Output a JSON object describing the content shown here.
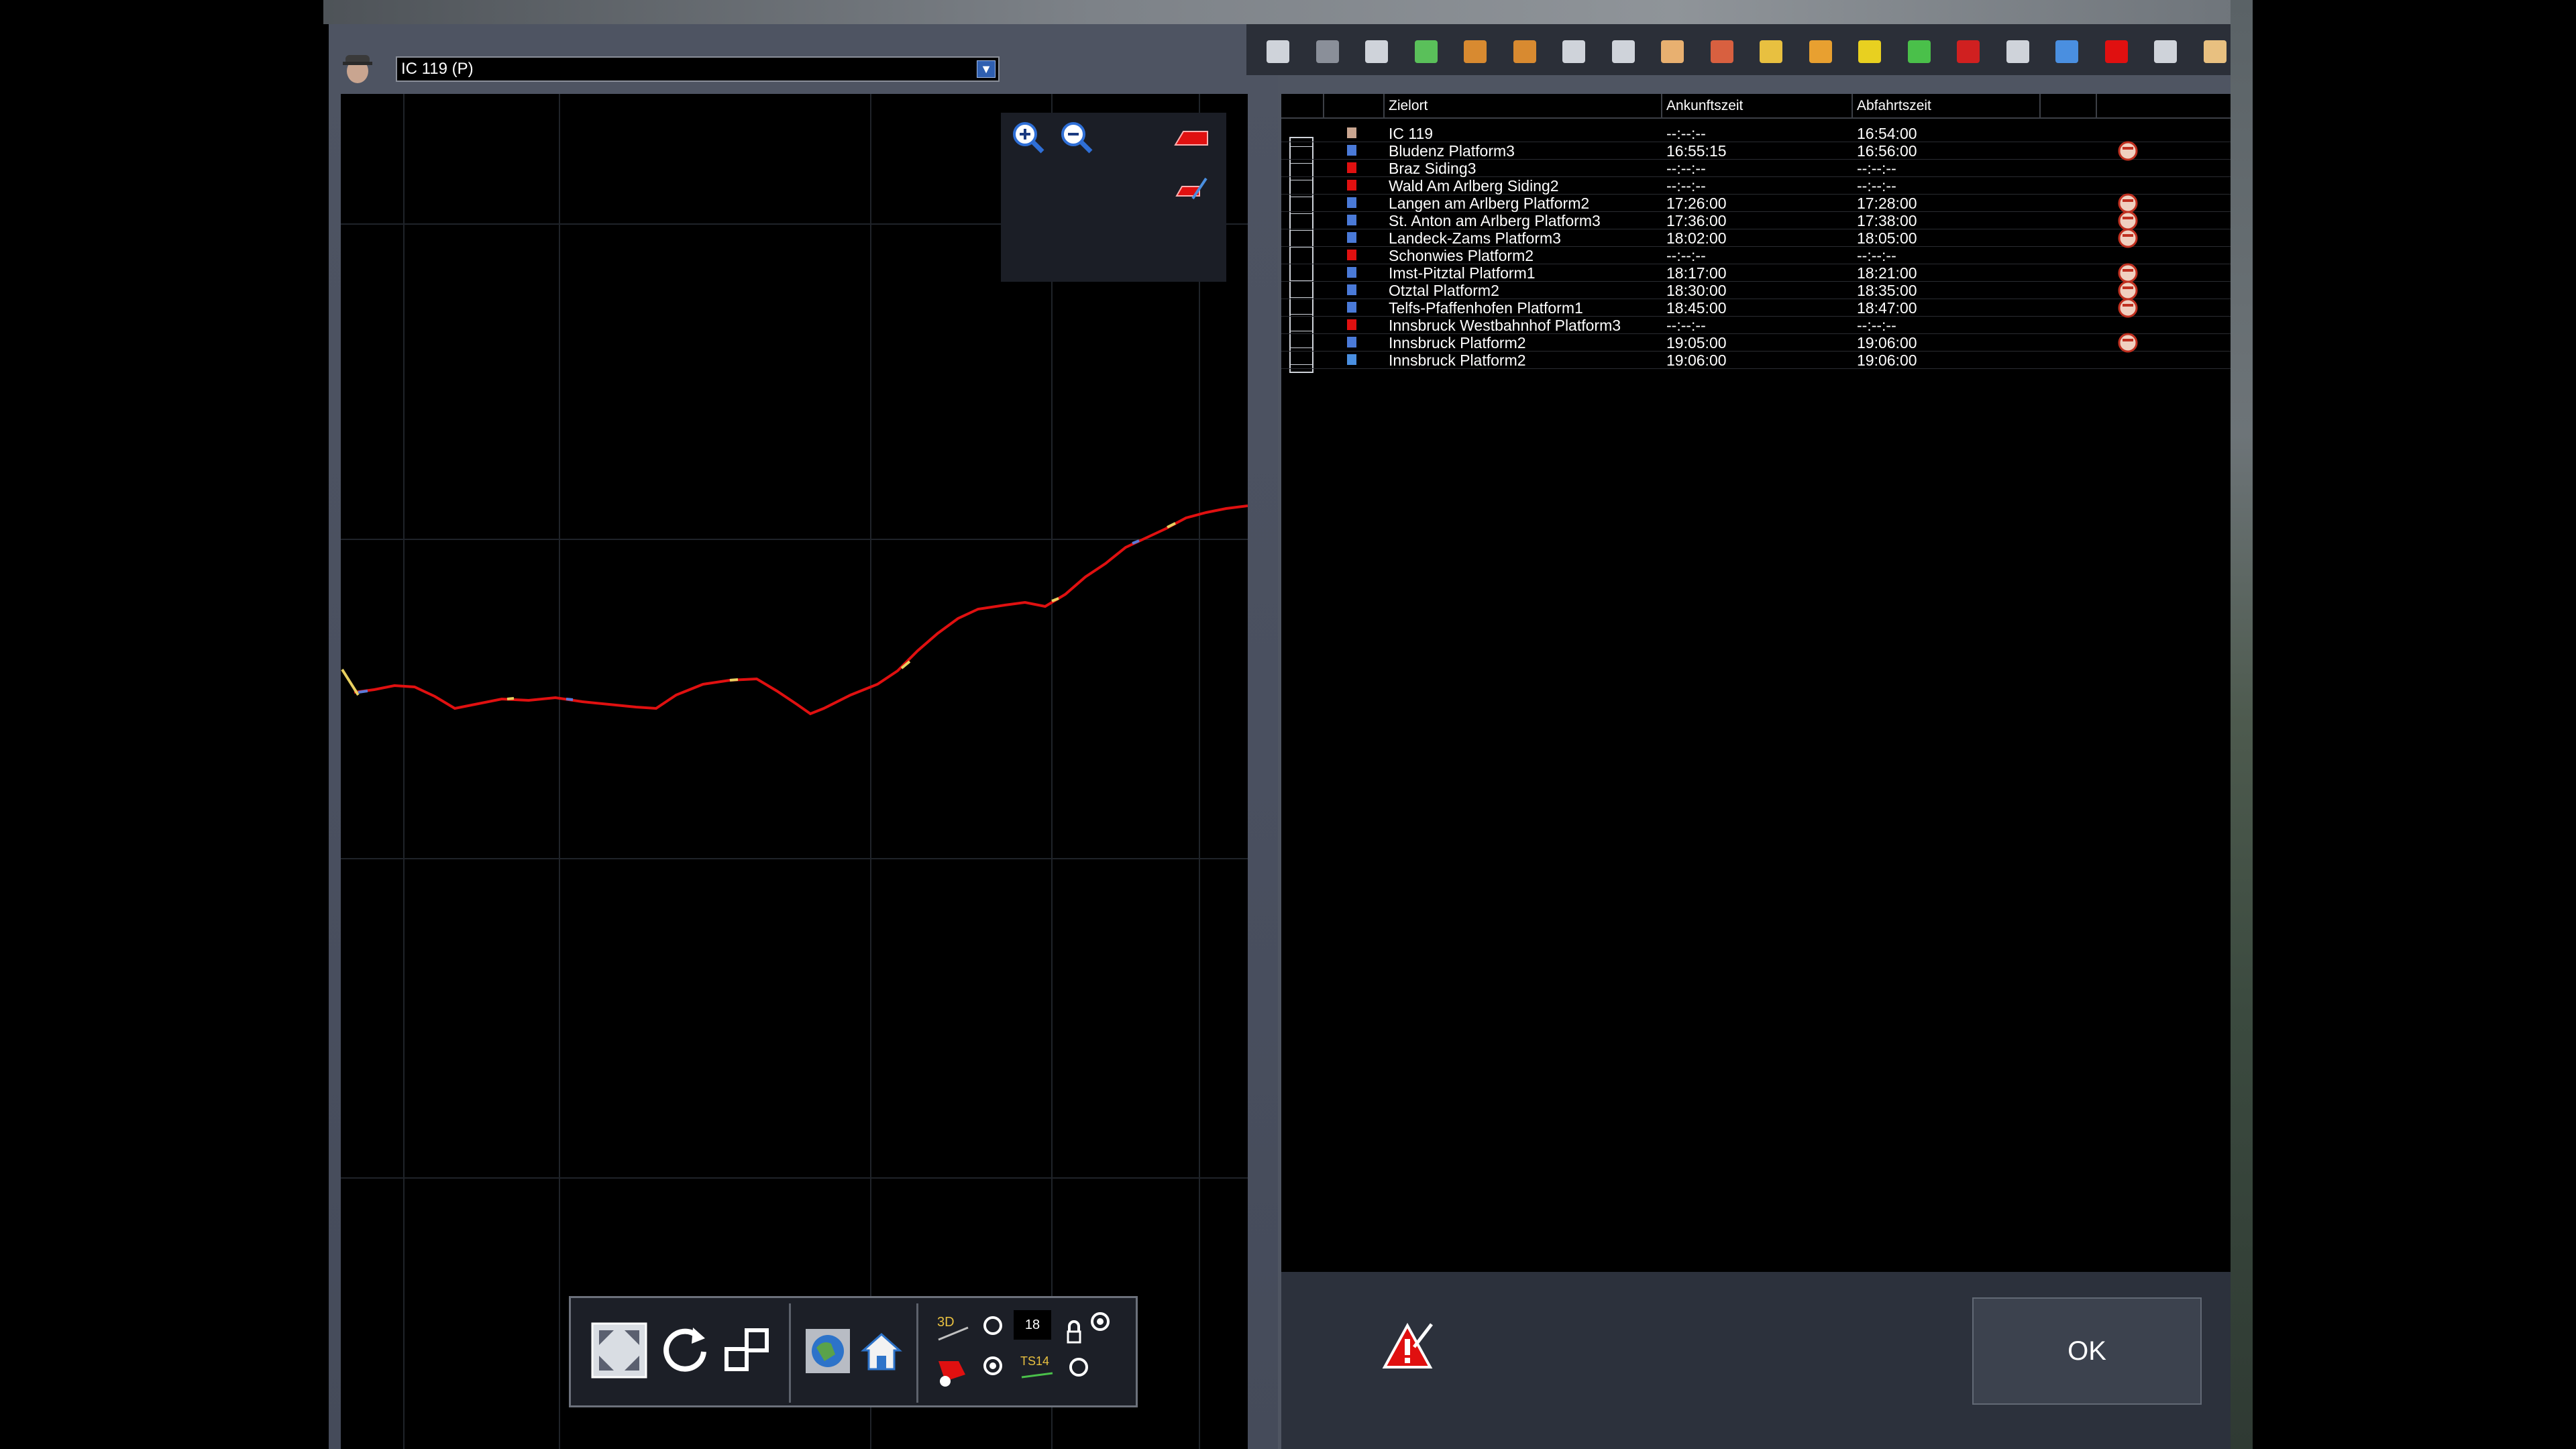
{
  "train": {
    "selected": "IC 119 (P)",
    "dropdown_glyph": "▼",
    "driver_icon": "driver-head-icon"
  },
  "map_tools": [
    {
      "name": "zoom-in-icon"
    },
    {
      "name": "zoom-out-icon"
    },
    {
      "name": "red-train-shape-icon"
    },
    {
      "name": "red-pencil-shape-icon"
    }
  ],
  "bottom_bar": {
    "speed_value": "18",
    "label_3d": "3D",
    "label_ts14": "TS14"
  },
  "toolbar_icons": [
    "save-icon",
    "trash-icon",
    "grid-small-icon",
    "grid-green-icon",
    "move-up-icon",
    "move-down-icon",
    "align-icon",
    "align-right-icon",
    "pointing-hand-icon",
    "passengers-icon",
    "edit-list-icon",
    "expand-icon",
    "add-arrow-icon",
    "add-green-icon",
    "remove-icon",
    "settings-icon",
    "exit-icon",
    "red-flag-icon",
    "panel-icon",
    "train-car-icon"
  ],
  "timetable": {
    "headers": {
      "destination": "Zielort",
      "arrival": "Ankunftszeit",
      "departure": "Abfahrtszeit"
    },
    "rows": [
      {
        "type": "head",
        "dest": "IC 119",
        "arr": "--:--:--",
        "dep": "16:54:00",
        "badge": false
      },
      {
        "type": "stop",
        "dest": "Bludenz Platform3",
        "arr": "16:55:15",
        "dep": "16:56:00",
        "badge": true
      },
      {
        "type": "flag",
        "dest": "Braz Siding3",
        "arr": "--:--:--",
        "dep": "--:--:--",
        "badge": false
      },
      {
        "type": "flag",
        "dest": "Wald Am Arlberg Siding2",
        "arr": "--:--:--",
        "dep": "--:--:--",
        "badge": false
      },
      {
        "type": "stop",
        "dest": "Langen am Arlberg Platform2",
        "arr": "17:26:00",
        "dep": "17:28:00",
        "badge": true
      },
      {
        "type": "stop",
        "dest": "St. Anton am Arlberg Platform3",
        "arr": "17:36:00",
        "dep": "17:38:00",
        "badge": true
      },
      {
        "type": "stop",
        "dest": "Landeck-Zams Platform3",
        "arr": "18:02:00",
        "dep": "18:05:00",
        "badge": true
      },
      {
        "type": "flag",
        "dest": "Schonwies Platform2",
        "arr": "--:--:--",
        "dep": "--:--:--",
        "badge": false
      },
      {
        "type": "stop",
        "dest": "Imst-Pitztal Platform1",
        "arr": "18:17:00",
        "dep": "18:21:00",
        "badge": true
      },
      {
        "type": "stop",
        "dest": "Otztal Platform2",
        "arr": "18:30:00",
        "dep": "18:35:00",
        "badge": true
      },
      {
        "type": "stop",
        "dest": "Telfs-Pfaffenhofen Platform1",
        "arr": "18:45:00",
        "dep": "18:47:00",
        "badge": true
      },
      {
        "type": "flag",
        "dest": "Innsbruck Westbahnhof Platform3",
        "arr": "--:--:--",
        "dep": "--:--:--",
        "badge": false
      },
      {
        "type": "stop",
        "dest": "Innsbruck Platform2",
        "arr": "19:05:00",
        "dep": "19:06:00",
        "badge": true
      },
      {
        "type": "end",
        "dest": "Innsbruck Platform2",
        "arr": "19:06:00",
        "dep": "19:06:00",
        "badge": false
      }
    ]
  },
  "footer": {
    "ok_label": "OK",
    "warning_icon": "warning-edit-icon"
  },
  "colors": {
    "route": "#e01010",
    "accent_yellow": "#e8d060",
    "panel": "#4f5562"
  }
}
